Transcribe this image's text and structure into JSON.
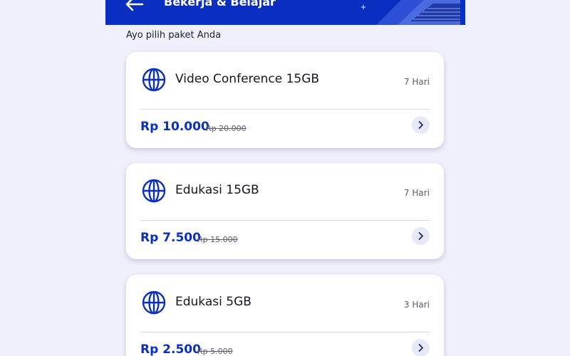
{
  "header": {
    "title": "Bekerja & Belajar",
    "back_icon": "arrow-left-icon"
  },
  "section_label": "Ayo pilih paket Anda",
  "packages": [
    {
      "name": "Video Conference 15GB",
      "duration": "7 Hari",
      "price": "Rp 10.000",
      "old_price": "Rp 20.000",
      "icon": "globe-icon"
    },
    {
      "name": "Edukasi 15GB",
      "duration": "7 Hari",
      "price": "Rp 7.500",
      "old_price": "Rp 15.000",
      "icon": "globe-icon"
    },
    {
      "name": "Edukasi 5GB",
      "duration": "3 Hari",
      "price": "Rp 2.500",
      "old_price": "Rp 5.000",
      "icon": "globe-icon"
    }
  ],
  "colors": {
    "accent": "#0a2fc0",
    "price": "#0b2fbf",
    "background": "#eff0fb",
    "card": "#ffffff"
  }
}
